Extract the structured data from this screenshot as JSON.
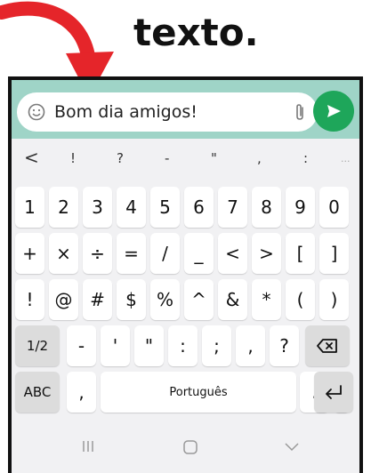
{
  "headline": "texto.",
  "chat": {
    "message": "Bom dia amigos!",
    "emoji_icon": "smiley-icon",
    "attach_icon": "paperclip-icon",
    "send_icon": "send-icon",
    "colors": {
      "bar": "#9fd4c7",
      "send": "#1ea65a",
      "arrow": "#e5252a"
    }
  },
  "toolbar": [
    "<",
    "!",
    "?",
    "-",
    "\"",
    ",",
    ":",
    "..."
  ],
  "rows": {
    "numbers": [
      "1",
      "2",
      "3",
      "4",
      "5",
      "6",
      "7",
      "8",
      "9",
      "0"
    ],
    "symbols1": [
      "+",
      "×",
      "÷",
      "=",
      "/",
      "_",
      "<",
      ">",
      "[",
      "]"
    ],
    "symbols2": [
      "!",
      "@",
      "#",
      "$",
      "%",
      "^",
      "&",
      "*",
      "(",
      ")"
    ],
    "page_key": "1/2",
    "symbols3": [
      "-",
      "'",
      "\"",
      ":",
      ";",
      ",",
      "?"
    ],
    "abc_key": "ABC",
    "comma_key": ",",
    "space_label": "Português",
    "period_key": "."
  }
}
